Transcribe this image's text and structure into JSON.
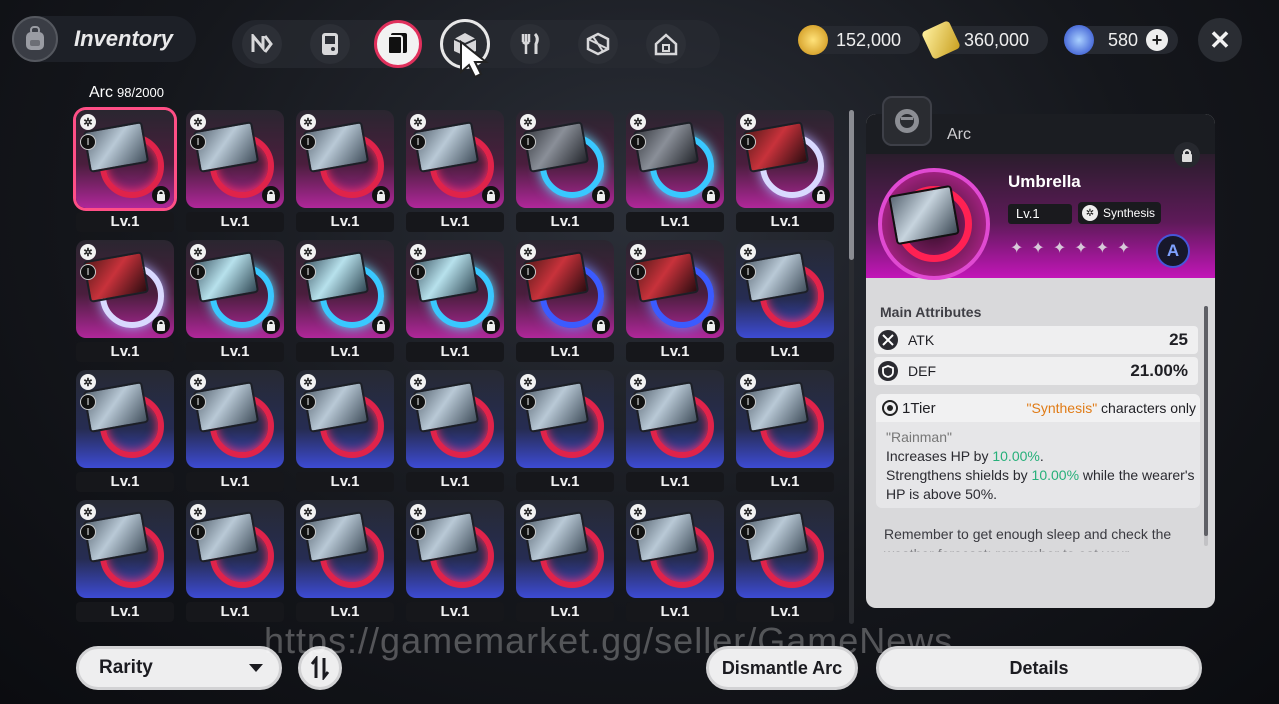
{
  "header": {
    "title": "Inventory",
    "tabs": [
      "n-icon",
      "handheld-icon",
      "arc-card-icon",
      "cube-icon",
      "food-icon",
      "box-icon",
      "home-icon"
    ],
    "active_tab": 2,
    "selected_tab": 3
  },
  "currencies": [
    {
      "name": "gold-coin",
      "value": "152,000",
      "color": "#e7b93b"
    },
    {
      "name": "ticket",
      "value": "360,000",
      "color": "#e3c24a"
    },
    {
      "name": "crystal",
      "value": "580",
      "color": "#3d6ff0"
    }
  ],
  "arc_count": {
    "label": "Arc",
    "value": "98/2000"
  },
  "grid": {
    "items": [
      {
        "level": "Lv.1",
        "frame": "pink",
        "art": "rainman",
        "locked": true,
        "selected": true
      },
      {
        "level": "Lv.1",
        "frame": "pink",
        "art": "rainman",
        "locked": true
      },
      {
        "level": "Lv.1",
        "frame": "pink",
        "art": "rainman",
        "locked": true
      },
      {
        "level": "Lv.1",
        "frame": "pink",
        "art": "rainman",
        "locked": true
      },
      {
        "level": "Lv.1",
        "frame": "pink",
        "art": "dark-blue",
        "locked": true
      },
      {
        "level": "Lv.1",
        "frame": "pink",
        "art": "dark-blue",
        "locked": true
      },
      {
        "level": "Lv.1",
        "frame": "pink",
        "art": "red-white",
        "locked": true
      },
      {
        "level": "Lv.1",
        "frame": "pink",
        "art": "red-white",
        "locked": true
      },
      {
        "level": "Lv.1",
        "frame": "pink",
        "art": "cyan-blue",
        "locked": true
      },
      {
        "level": "Lv.1",
        "frame": "pink",
        "art": "cyan-blue",
        "locked": true
      },
      {
        "level": "Lv.1",
        "frame": "pink",
        "art": "cyan-blue",
        "locked": true
      },
      {
        "level": "Lv.1",
        "frame": "pink",
        "art": "red-elec",
        "locked": true
      },
      {
        "level": "Lv.1",
        "frame": "pink",
        "art": "red-elec",
        "locked": true
      },
      {
        "level": "Lv.1",
        "frame": "blue",
        "art": "rainman",
        "locked": false
      },
      {
        "level": "Lv.1",
        "frame": "blue",
        "art": "rainman",
        "locked": false
      },
      {
        "level": "Lv.1",
        "frame": "blue",
        "art": "rainman",
        "locked": false
      },
      {
        "level": "Lv.1",
        "frame": "blue",
        "art": "rainman",
        "locked": false
      },
      {
        "level": "Lv.1",
        "frame": "blue",
        "art": "rainman",
        "locked": false
      },
      {
        "level": "Lv.1",
        "frame": "blue",
        "art": "rainman",
        "locked": false
      },
      {
        "level": "Lv.1",
        "frame": "blue",
        "art": "rainman",
        "locked": false
      },
      {
        "level": "Lv.1",
        "frame": "blue",
        "art": "rainman",
        "locked": false
      },
      {
        "level": "Lv.1",
        "frame": "blue",
        "art": "rainman",
        "locked": false
      },
      {
        "level": "Lv.1",
        "frame": "blue",
        "art": "rainman",
        "locked": false
      },
      {
        "level": "Lv.1",
        "frame": "blue",
        "art": "rainman",
        "locked": false
      },
      {
        "level": "Lv.1",
        "frame": "blue",
        "art": "rainman",
        "locked": false
      },
      {
        "level": "Lv.1",
        "frame": "blue",
        "art": "rainman",
        "locked": false
      },
      {
        "level": "Lv.1",
        "frame": "blue",
        "art": "rainman",
        "locked": false
      },
      {
        "level": "Lv.1",
        "frame": "blue",
        "art": "rainman",
        "locked": false
      }
    ]
  },
  "detail": {
    "header": "Arc",
    "name": "Umbrella",
    "level": "Lv.1",
    "synthesis_tag": "Synthesis",
    "star_count": 6,
    "rank": "A",
    "main_attributes_label": "Main Attributes",
    "atk_label": "ATK",
    "atk_value": "25",
    "def_label": "DEF",
    "def_value": "21.00%",
    "tier_label": "1Tier",
    "tier_req_highlight": "\"Synthesis\"",
    "tier_req_rest": " characters only",
    "effect_name": "\"Rainman\"",
    "effect_line1_a": "Increases HP by ",
    "effect_line1_b": "10.00%",
    "effect_line1_c": ".",
    "effect_line2_a": "Strengthens shields by ",
    "effect_line2_b": "10.00%",
    "effect_line2_c": " while the wearer's HP is above 50%.",
    "flavor": "Remember to get enough sleep and check the weather forecast; remember to eat your"
  },
  "bottom": {
    "rarity_label": "Rarity",
    "dismantle_label": "Dismantle Arc",
    "details_label": "Details"
  },
  "watermark": "https://gamemarket.gg/seller/GameNews"
}
